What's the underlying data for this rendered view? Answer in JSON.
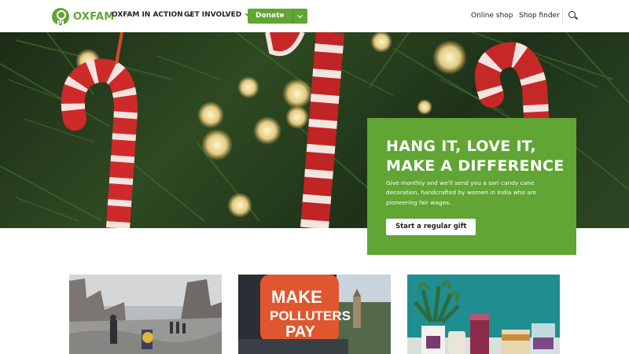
{
  "header": {
    "logo_text": "OXFAM",
    "nav": [
      {
        "label": "OXFAM IN ACTION"
      },
      {
        "label": "GET INVOLVED"
      }
    ],
    "donate_label": "Donate",
    "online_shop": "Online shop",
    "shop_finder": "Shop finder"
  },
  "hero": {
    "title": "HANG IT, LOVE IT, MAKE A DIFFERENCE",
    "text": "Give monthly and we'll send you a sari candy cane decoration, handcrafted by women in India who are pioneering fair wages.",
    "cta": "Start a regular gift"
  },
  "cards": [
    {
      "icon": "conflict-street-photo"
    },
    {
      "icon": "make-polluters-pay-photo",
      "sign_text": [
        "MAKE",
        "POLLUTERS",
        "PAY"
      ]
    },
    {
      "icon": "shop-products-photo"
    }
  ],
  "colors": {
    "brand_green": "#61a534",
    "candy_red": "#cf2a2a"
  }
}
